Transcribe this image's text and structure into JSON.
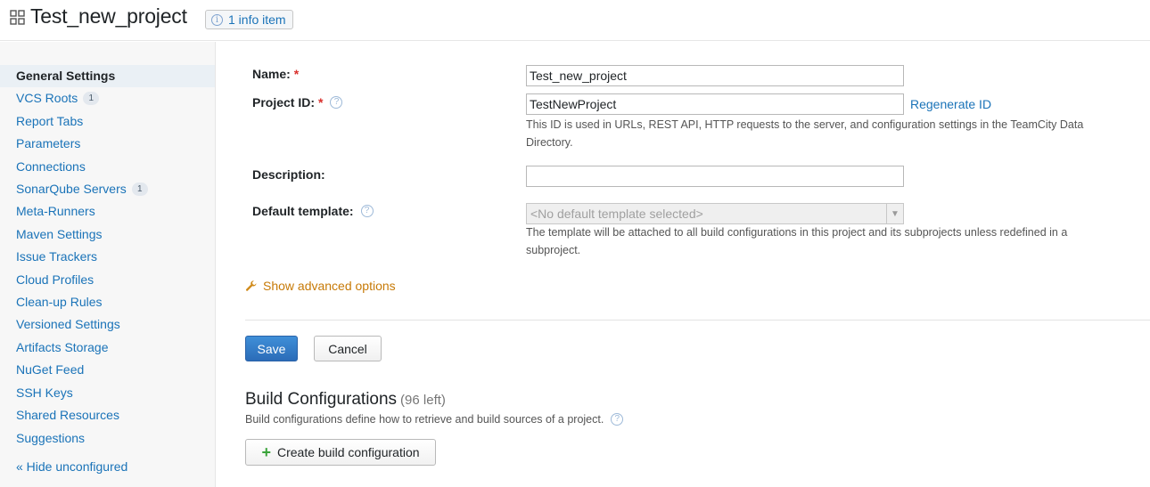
{
  "header": {
    "title": "Test_new_project",
    "info_badge": "1 info item"
  },
  "sidebar": {
    "items": [
      {
        "label": "General Settings",
        "active": true
      },
      {
        "label": "VCS Roots",
        "count": "1"
      },
      {
        "label": "Report Tabs"
      },
      {
        "label": "Parameters"
      },
      {
        "label": "Connections"
      },
      {
        "label": "SonarQube Servers",
        "count": "1"
      },
      {
        "label": "Meta-Runners"
      },
      {
        "label": "Maven Settings"
      },
      {
        "label": "Issue Trackers"
      },
      {
        "label": "Cloud Profiles"
      },
      {
        "label": "Clean-up Rules"
      },
      {
        "label": "Versioned Settings"
      },
      {
        "label": "Artifacts Storage"
      },
      {
        "label": "NuGet Feed"
      },
      {
        "label": "SSH Keys"
      },
      {
        "label": "Shared Resources"
      },
      {
        "label": "Suggestions"
      }
    ],
    "hide_unconfigured": "« Hide unconfigured"
  },
  "form": {
    "name": {
      "label": "Name:",
      "required_mark": "*",
      "value": "Test_new_project"
    },
    "project_id": {
      "label": "Project ID:",
      "required_mark": "*",
      "value": "TestNewProject",
      "regenerate_link": "Regenerate ID",
      "note": "This ID is used in URLs, REST API, HTTP requests to the server, and configuration settings in the TeamCity Data Directory."
    },
    "description": {
      "label": "Description:",
      "value": ""
    },
    "default_template": {
      "label": "Default template:",
      "selected": "<No default template selected>",
      "note": "The template will be attached to all build configurations in this project and its subprojects unless redefined in a subproject."
    },
    "advanced_link": "Show advanced options",
    "save_label": "Save",
    "cancel_label": "Cancel"
  },
  "build_configurations": {
    "title": "Build Configurations",
    "remaining": "(96 left)",
    "description": "Build configurations define how to retrieve and build sources of a project.",
    "create_label": "Create build configuration"
  },
  "colors": {
    "link": "#1a73b8",
    "advanced": "#c77a07",
    "primary_button": "#2b6cb8",
    "required": "#d9302c"
  }
}
